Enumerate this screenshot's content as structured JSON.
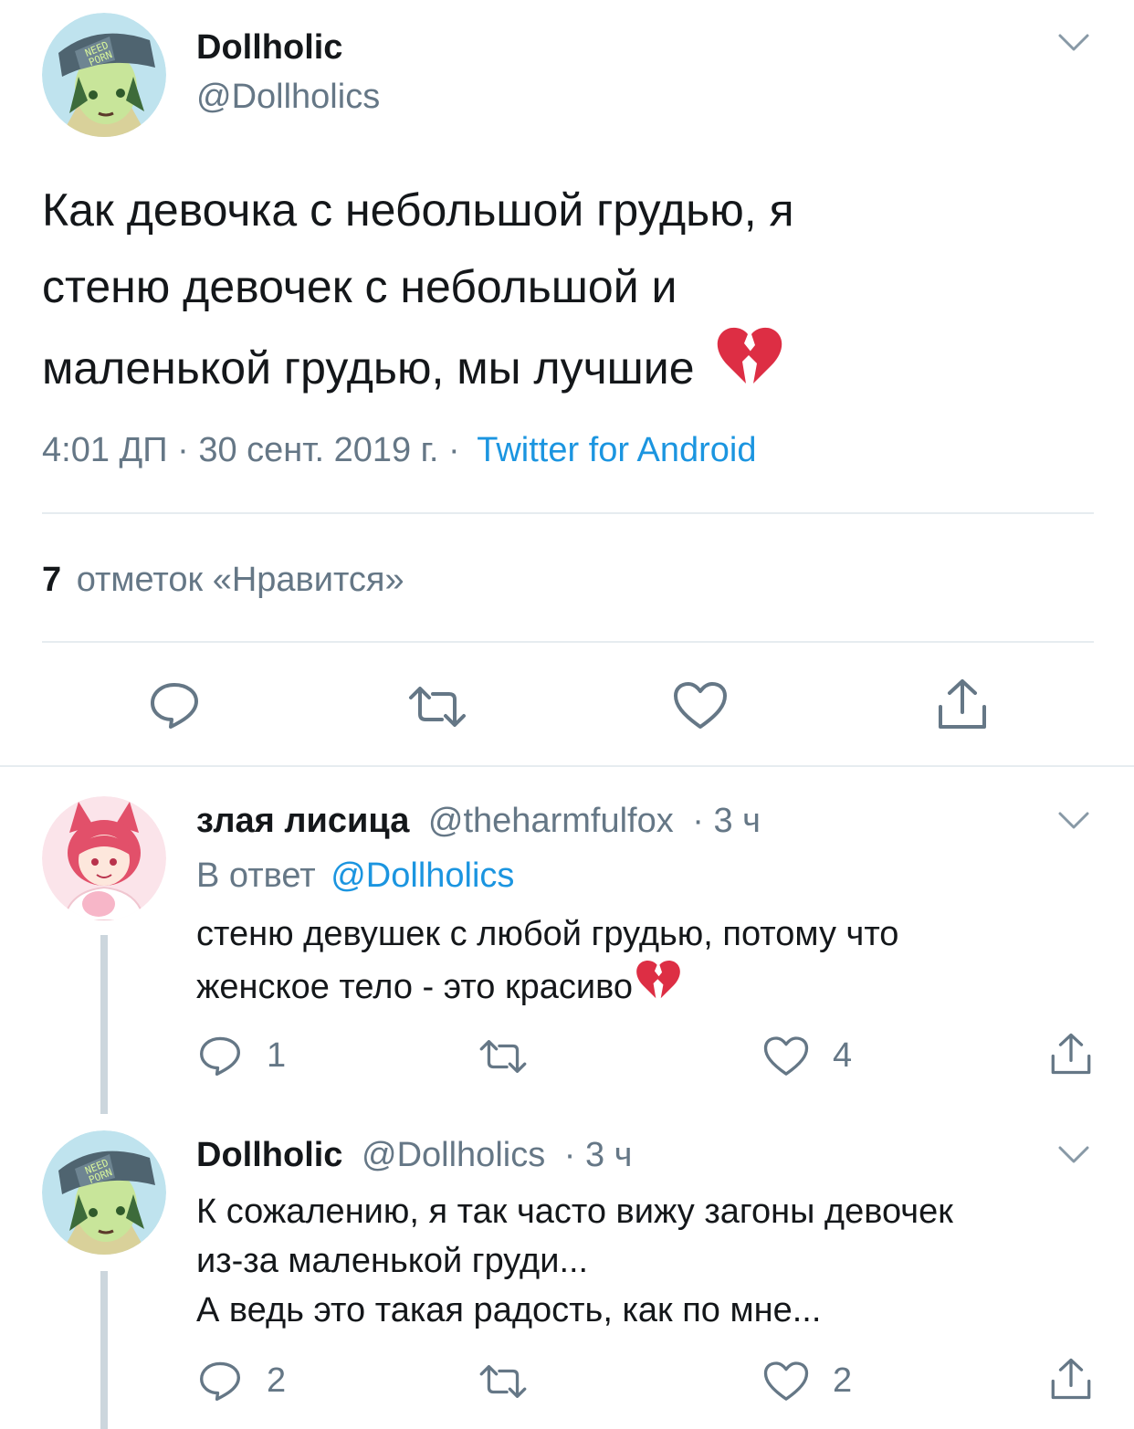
{
  "main_tweet": {
    "display_name": "Dollholic",
    "handle": "@Dollholics",
    "avatar_cap_text": "NEED PORN",
    "text_lines": [
      "Как девочка с небольшой грудью, я",
      "стеню девочек с небольшой и",
      "маленькой грудью, мы лучшие"
    ],
    "emoji": "broken-heart",
    "timestamp": "4:01 ДП · 30 сент. 2019 г. ·",
    "source": "Twitter for Android",
    "likes_count": "7",
    "likes_label": "отметок «Нравится»"
  },
  "reply_1": {
    "display_name": "злая лисица",
    "handle": "@theharmfulfox",
    "time": "· 3 ч",
    "reply_to_prefix": "В ответ",
    "reply_to_handle": "@Dollholics",
    "text_lines": [
      "стеню девушек с любой грудью, потому что",
      "женское тело - это красиво"
    ],
    "reply_count": "1",
    "like_count": "4"
  },
  "reply_2": {
    "display_name": "Dollholic",
    "handle": "@Dollholics",
    "time": "· 3 ч",
    "text_lines": [
      "К сожалению, я так часто вижу загоны девочек",
      "из-за маленькой груди...",
      "А ведь это такая радость, как по мне..."
    ],
    "reply_count": "2",
    "like_count": "2"
  },
  "colors": {
    "link_blue": "#1b95e0",
    "secondary_gray": "#657786",
    "divider": "#e6ecf0",
    "thread_line": "#ccd6dd",
    "broken_heart": "#dd2e44"
  }
}
